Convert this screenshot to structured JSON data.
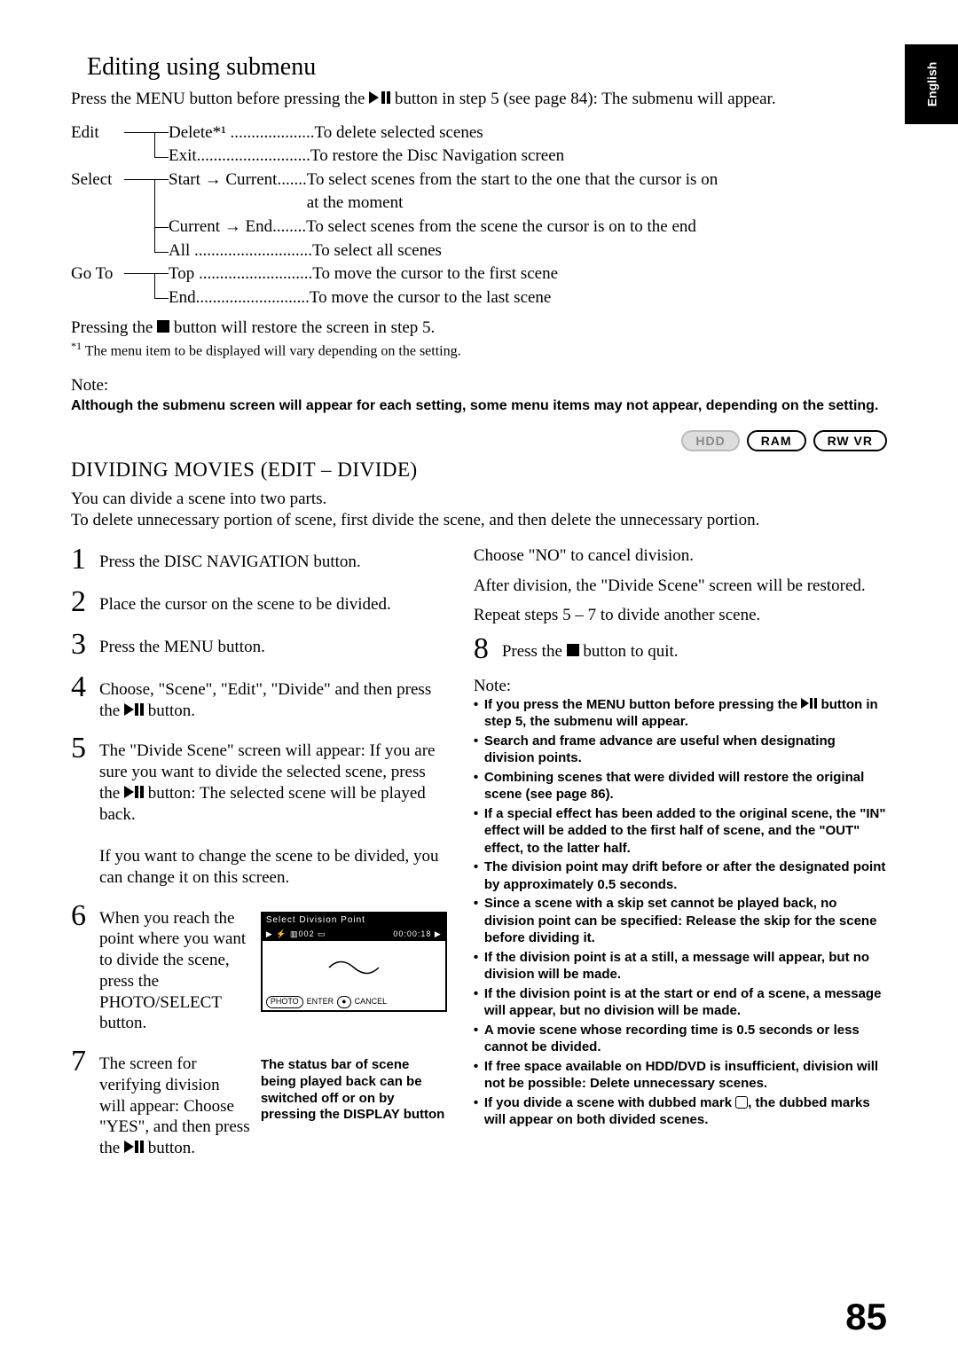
{
  "side_tab": "English",
  "section1_title": "Editing using submenu",
  "section1_intro": "Press the MENU button before pressing the ▶/❚❚ button in step 5 (see page 84): The submenu will appear.",
  "tree": {
    "edit": {
      "label": "Edit",
      "items": [
        {
          "name": "Delete*¹",
          "desc": "To delete selected scenes"
        },
        {
          "name": "Exit",
          "desc": "To restore the Disc Navigation screen"
        }
      ]
    },
    "select": {
      "label": "Select",
      "items": [
        {
          "name": "Start → Current",
          "desc": "To select scenes from the start to the one that the cursor is on at the moment"
        },
        {
          "name": "Current → End",
          "desc": "To select scenes from the scene the cursor is on to the end"
        },
        {
          "name": "All",
          "desc": "To select all scenes"
        }
      ]
    },
    "goto": {
      "label": "Go To",
      "items": [
        {
          "name": "Top",
          "desc": "To move the cursor to the first scene"
        },
        {
          "name": "End",
          "desc": "To move the cursor to the last scene"
        }
      ]
    }
  },
  "press_stop": "Pressing the ■ button will restore the screen in step 5.",
  "footnote": "*¹ The menu item to be displayed will vary depending on the setting.",
  "note_label": "Note:",
  "note_bold": "Although the submenu screen will appear for each setting, some menu items may not appear, depending on the setting.",
  "badges": [
    "HDD",
    "RAM",
    "RW VR"
  ],
  "h2": "DIVIDING MOVIES (EDIT – DIVIDE)",
  "h2_para1": "You can divide a scene into two parts.",
  "h2_para2": "To delete unnecessary portion of scene, first divide the scene, and then delete the unnecessary portion.",
  "steps_left": [
    "Press the DISC NAVIGATION button.",
    "Place the cursor on the scene to be divided.",
    "Press the MENU button.",
    "Choose, \"Scene\", \"Edit\", \"Divide\" and then press the ▶/❚❚ button.",
    "The \"Divide Scene\" screen will appear: If you are sure you want to divide the selected scene, press the ▶/❚❚ button: The selected scene will be played back.\n\nIf you want to change the scene to be divided, you can change it on this screen.",
    "When you reach the point where you want to divide the scene, press the PHOTO/SELECT button.",
    "The screen for verifying division will appear: Choose \"YES\", and then press the ▶/❚❚ button."
  ],
  "screenshot": {
    "title": "Select Division Point",
    "info_left": "002",
    "info_right": "00:00:18",
    "footer_photo": "PHOTO",
    "footer_enter": "ENTER",
    "footer_stop": "●",
    "footer_cancel": "CANCEL"
  },
  "caption": "The status bar of scene being played back can be switched off or on by pressing the DISPLAY button",
  "right_continue_lines": [
    "Choose \"NO\" to cancel division.",
    "After division, the \"Divide Scene\" screen will be restored.",
    "Repeat steps 5 – 7 to divide another scene."
  ],
  "step8": "Press the ■ button to quit.",
  "right_note_label": "Note:",
  "right_notes": [
    "If you press the MENU button before pressing the ▶/❚❚ button in step 5, the submenu will appear.",
    "Search and frame advance are useful when designating division points.",
    "Combining scenes that were divided will restore the original scene (see page 86).",
    "If a special effect has been added to the original scene, the \"IN\" effect will be added to the first half of scene, and the \"OUT\" effect, to the latter half.",
    "The division point may drift before or after the designated point by approximately 0.5 seconds.",
    "Since a scene with a skip set cannot be played back, no division point can be specified: Release the skip for the scene before dividing it.",
    "If the division point is at a still, a message will appear, but no division will be made.",
    "If the division point is at the start or end of a scene, a message will appear, but no division will be made.",
    "A movie scene whose recording time is 0.5 seconds or less cannot be divided.",
    "If free space available on HDD/DVD is insufficient, division will not be possible: Delete unnecessary scenes.",
    "If you divide a scene with dubbed mark ☑, the dubbed marks will appear on both divided scenes."
  ],
  "page_number": "85"
}
